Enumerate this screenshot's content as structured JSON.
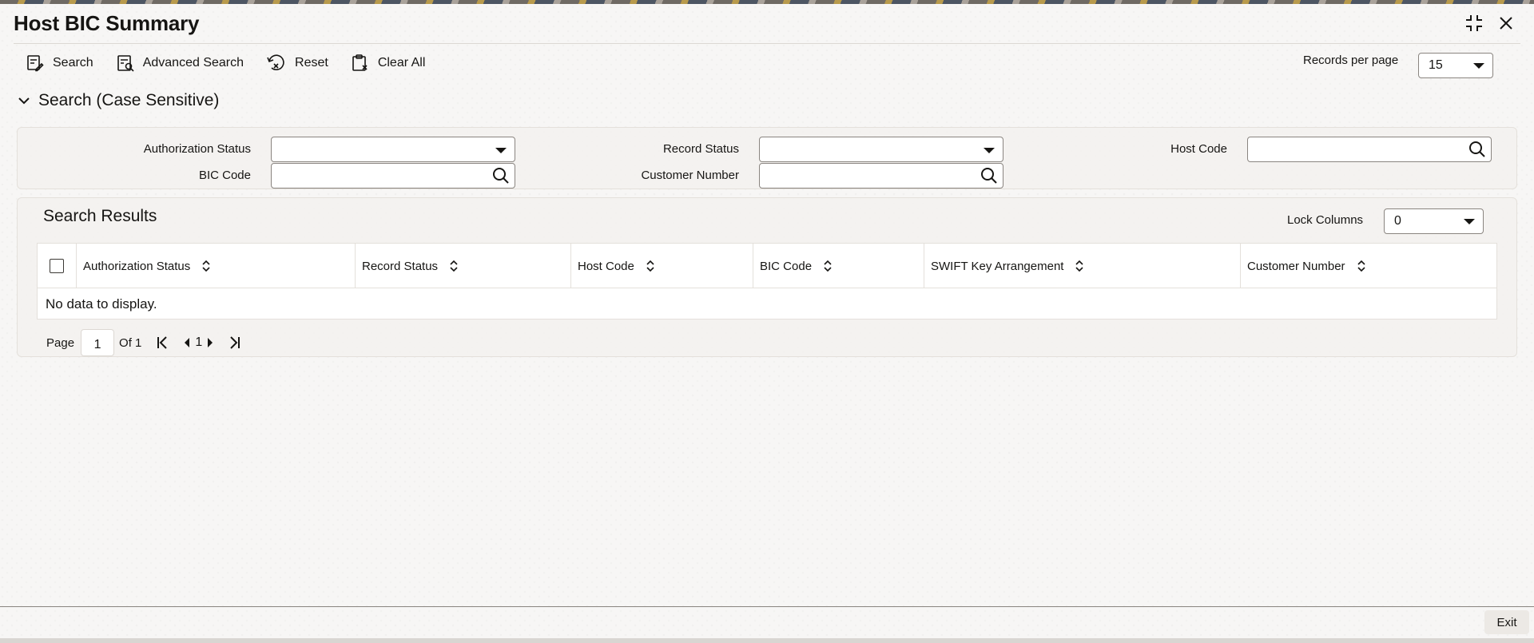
{
  "window": {
    "title": "Host BIC Summary"
  },
  "toolbar": {
    "search_label": "Search",
    "advanced_search_label": "Advanced Search",
    "reset_label": "Reset",
    "clear_all_label": "Clear All"
  },
  "records_per_page": {
    "label": "Records per page",
    "value": "15"
  },
  "search_section": {
    "title": "Search (Case Sensitive)",
    "fields": {
      "authorization_status": {
        "label": "Authorization Status",
        "value": ""
      },
      "record_status": {
        "label": "Record Status",
        "value": ""
      },
      "host_code": {
        "label": "Host Code",
        "value": ""
      },
      "bic_code": {
        "label": "BIC Code",
        "value": ""
      },
      "customer_number": {
        "label": "Customer Number",
        "value": ""
      }
    }
  },
  "results": {
    "title": "Search Results",
    "lock_columns": {
      "label": "Lock Columns",
      "value": "0"
    },
    "columns": [
      "Authorization Status",
      "Record Status",
      "Host Code",
      "BIC Code",
      "SWIFT Key Arrangement",
      "Customer Number"
    ],
    "empty_message": "No data to display."
  },
  "pagination": {
    "page_label": "Page",
    "current_page": "1",
    "of_label": "Of 1",
    "nav_page": "1"
  },
  "footer": {
    "exit_label": "Exit"
  },
  "colors": {
    "background": "#f7f6f5",
    "text": "#161513",
    "border": "#8a8580",
    "panel": "#f3f1ee"
  },
  "icons": [
    "maximize-icon",
    "close-icon",
    "search-icon",
    "advanced-search-icon",
    "reset-icon",
    "clear-all-icon",
    "chevron-down-icon",
    "sort-icon",
    "first-page-icon",
    "prev-page-icon",
    "next-page-icon",
    "last-page-icon"
  ]
}
